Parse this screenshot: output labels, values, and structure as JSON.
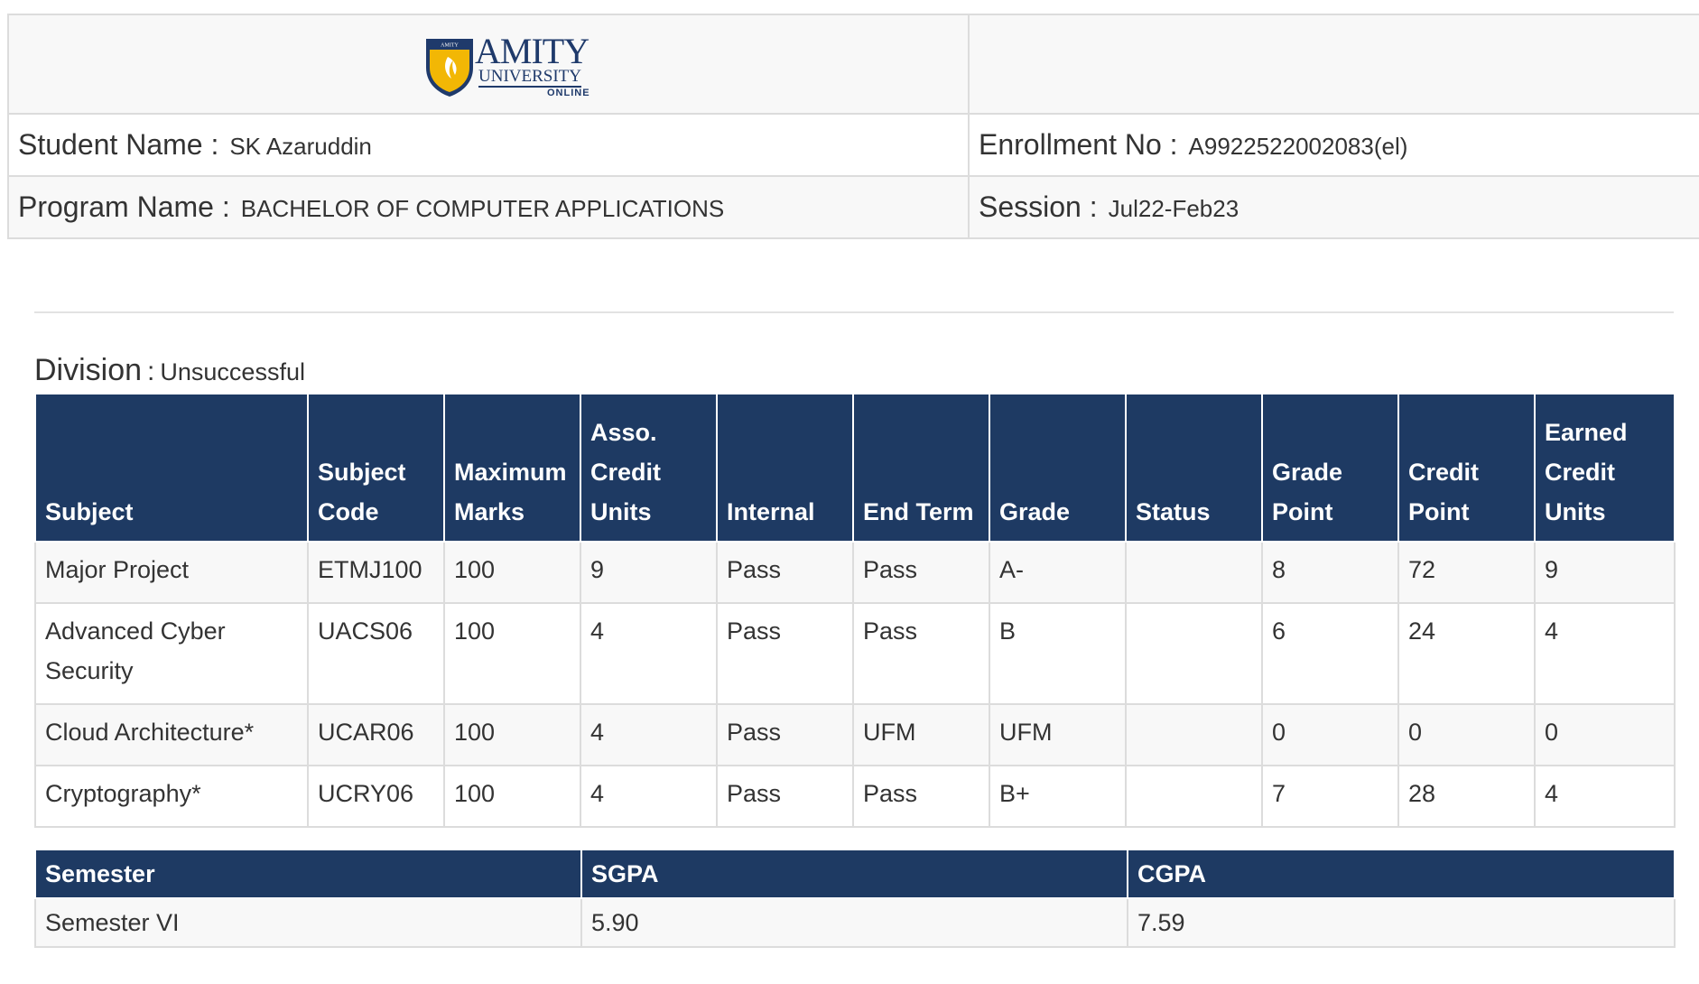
{
  "header": {
    "logo": {
      "title": "AMITY",
      "subtitle": "UNIVERSITY",
      "tagline": "ONLINE",
      "shield_text": "AMITY"
    },
    "student_name_label": "Student Name :",
    "student_name": "SK Azaruddin",
    "enrollment_label": "Enrollment No :",
    "enrollment_no": "A9922522002083(el)",
    "program_label": "Program Name :",
    "program_name": "BACHELOR OF COMPUTER APPLICATIONS",
    "session_label": "Session :",
    "session": "Jul22-Feb23"
  },
  "division": {
    "label": "Division",
    "separator": ":",
    "value": "Unsuccessful"
  },
  "marks": {
    "columns": [
      "Subject",
      "Subject Code",
      "Maximum Marks",
      "Asso. Credit Units",
      "Internal",
      "End Term",
      "Grade",
      "Status",
      "Grade Point",
      "Credit Point",
      "Earned Credit Units"
    ],
    "rows": [
      [
        "Major Project",
        "ETMJ100",
        "100",
        "9",
        "Pass",
        "Pass",
        "A-",
        "",
        "8",
        "72",
        "9"
      ],
      [
        "Advanced Cyber Security",
        "UACS06",
        "100",
        "4",
        "Pass",
        "Pass",
        "B",
        "",
        "6",
        "24",
        "4"
      ],
      [
        "Cloud Architecture*",
        "UCAR06",
        "100",
        "4",
        "Pass",
        "UFM",
        "UFM",
        "",
        "0",
        "0",
        "0"
      ],
      [
        "Cryptography*",
        "UCRY06",
        "100",
        "4",
        "Pass",
        "Pass",
        "B+",
        "",
        "7",
        "28",
        "4"
      ]
    ]
  },
  "summary": {
    "columns": [
      "Semester",
      "SGPA",
      "CGPA"
    ],
    "rows": [
      [
        "Semester VI",
        "5.90",
        "7.59"
      ]
    ]
  },
  "colors": {
    "header_navy": "#1e3a63",
    "logo_gold": "#f2b705",
    "logo_navy": "#1f3a6b"
  }
}
